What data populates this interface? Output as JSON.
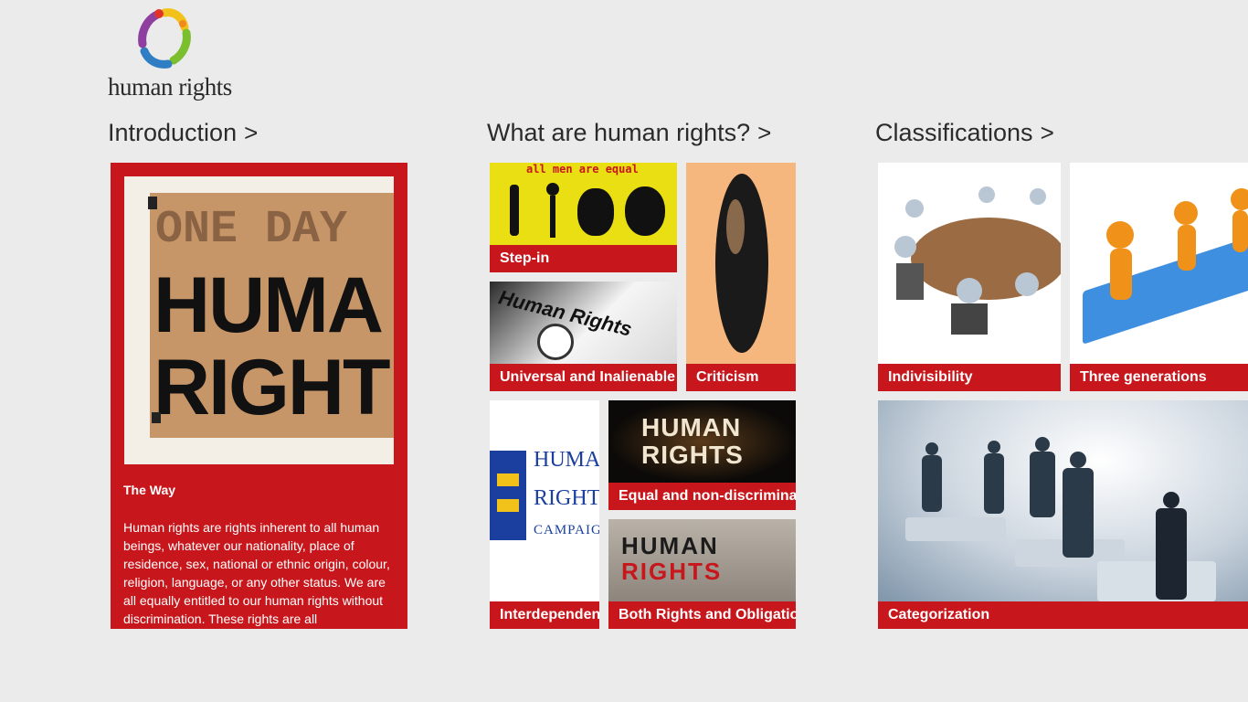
{
  "app": {
    "logo_text": "human rights"
  },
  "groups": [
    {
      "title": "Introduction",
      "chevron": ">"
    },
    {
      "title": "What are human rights?",
      "chevron": ">"
    },
    {
      "title": "Classifications",
      "chevron": ">"
    }
  ],
  "intro": {
    "title": "The Way",
    "body": "Human rights are rights inherent to all human beings, whatever our nationality, place of residence, sex, national or ethnic origin, colour, religion, language, or any other status. We are all equally entitled to our human rights without discrimination. These rights are all",
    "image_lines": [
      "ONE DAY",
      "HUMA",
      "RIGHT"
    ]
  },
  "what_tiles": {
    "step_in": {
      "caption": "Step-in",
      "image_text": "all men are equal"
    },
    "universal": {
      "caption": "Universal and Inalienable",
      "image_text": "Human Rights"
    },
    "criticism": {
      "caption": "Criticism"
    },
    "interdependent": {
      "caption": "Interdependent",
      "image_lines": [
        "HUMAN",
        "RIGHTS",
        "CAMPAIGN"
      ]
    },
    "equal": {
      "caption": "Equal and non-discriminate",
      "image_lines": [
        "HUMAN",
        "RIGHTS"
      ]
    },
    "both": {
      "caption": "Both Rights and Obligations",
      "image_lines": [
        "HUMAN",
        "RIGHTS"
      ]
    }
  },
  "class_tiles": {
    "indivisibility": {
      "caption": "Indivisibility"
    },
    "three_generations": {
      "caption": "Three generations"
    },
    "categorization": {
      "caption": "Categorization"
    }
  },
  "colors": {
    "accent": "#c8171c",
    "background": "#ebebeb"
  }
}
